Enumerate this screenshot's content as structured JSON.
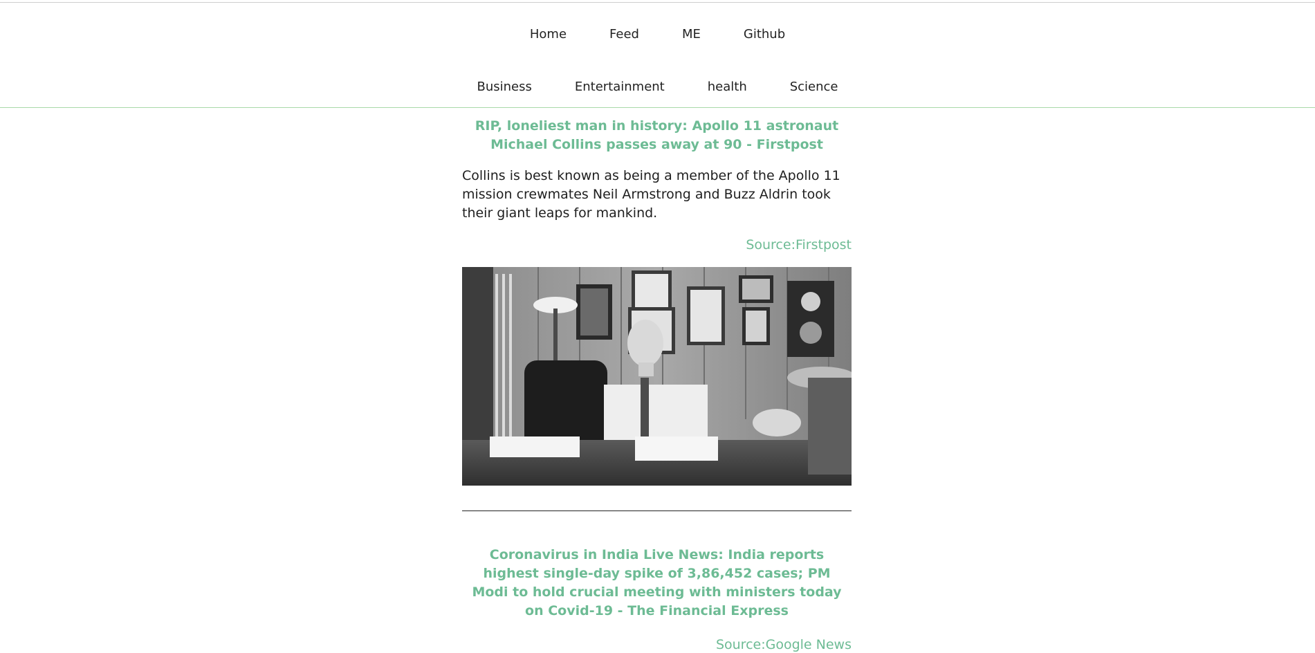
{
  "nav": {
    "main": [
      "Home",
      "Feed",
      "ME",
      "Github"
    ],
    "categories": [
      "Business",
      "Entertainment",
      "health",
      "Science"
    ]
  },
  "articles": [
    {
      "title": "RIP, loneliest man in history: Apollo 11 astronaut Michael Collins passes away at 90 - Firstpost",
      "description": "Collins is best known as being a member of the Apollo 11 mission crewmates Neil Armstrong and Buzz Aldrin took their giant leaps for mankind.",
      "source": "Source:Firstpost"
    },
    {
      "title": "Coronavirus in India Live News: India reports highest single-day spike of 3,86,452 cases; PM Modi to hold crucial meeting with ministers today on Covid-19 - The Financial Express",
      "source": "Source:Google News"
    }
  ],
  "colors": {
    "accent": "#6dbb94",
    "rule": "#a9d9a9"
  }
}
